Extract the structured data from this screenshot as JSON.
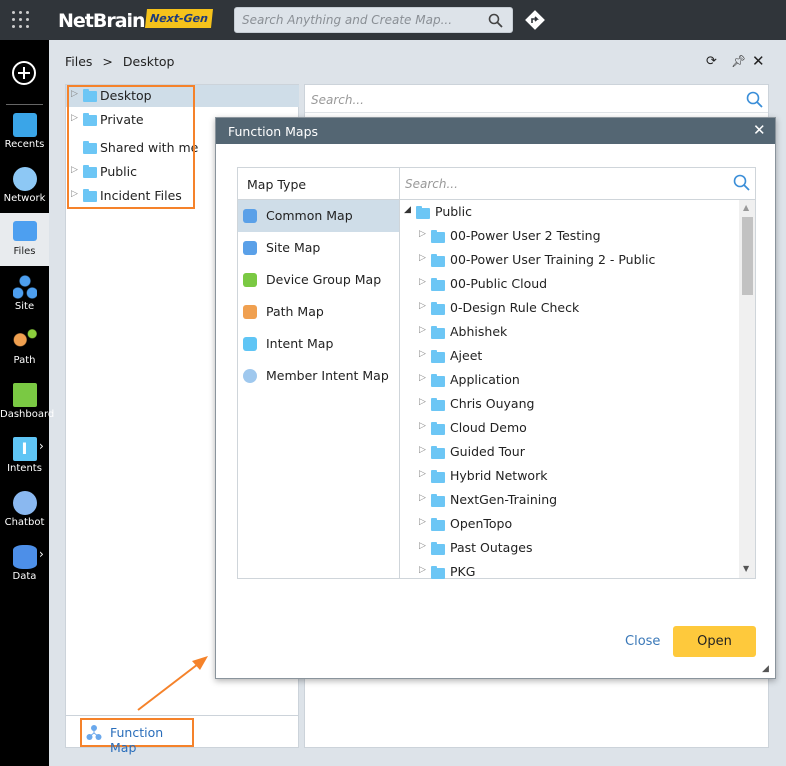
{
  "topbar": {
    "logo": "NetBrain",
    "logo_badge": "Next-Gen",
    "search_placeholder": "Search Anything and Create Map..."
  },
  "sidebar": {
    "items": [
      {
        "label": "Recents",
        "icon": "recents-icon"
      },
      {
        "label": "Network",
        "icon": "network-icon"
      },
      {
        "label": "Files",
        "icon": "files-icon",
        "active": true
      },
      {
        "label": "Site",
        "icon": "site-icon"
      },
      {
        "label": "Path",
        "icon": "path-icon"
      },
      {
        "label": "Dashboard",
        "icon": "dashboard-icon"
      },
      {
        "label": "Intents",
        "icon": "intents-icon"
      },
      {
        "label": "Chatbot",
        "icon": "chatbot-icon"
      },
      {
        "label": "Data",
        "icon": "data-icon"
      }
    ]
  },
  "breadcrumb": {
    "root": "Files",
    "sep": ">",
    "current": "Desktop"
  },
  "file_tree": [
    {
      "label": "Desktop",
      "expandable": true,
      "selected": true
    },
    {
      "label": "Private",
      "expandable": true
    },
    {
      "label": "Shared with me",
      "expandable": false
    },
    {
      "label": "Public",
      "expandable": true
    },
    {
      "label": "Incident Files",
      "expandable": true
    }
  ],
  "right_search_placeholder": "Search...",
  "function_map_label": "Function Map",
  "dialog": {
    "title": "Function Maps",
    "map_type_header": "Map Type",
    "search_placeholder": "Search...",
    "map_types": [
      {
        "label": "Common Map",
        "selected": true
      },
      {
        "label": "Site Map"
      },
      {
        "label": "Device Group Map"
      },
      {
        "label": "Path Map"
      },
      {
        "label": "Intent Map"
      },
      {
        "label": "Member Intent Map"
      }
    ],
    "root_folder": "Public",
    "folders": [
      "00-Power User 2 Testing",
      "00-Power User Training 2 - Public",
      "00-Public Cloud",
      "0-Design Rule Check",
      "Abhishek",
      "Ajeet",
      "Application",
      "Chris Ouyang",
      "Cloud Demo",
      "Guided Tour",
      "Hybrid Network",
      "NextGen-Training",
      "OpenTopo",
      "Past Outages",
      "PKG"
    ],
    "close_label": "Close",
    "open_label": "Open"
  },
  "colors": {
    "accent_orange": "#f5822a",
    "open_button": "#fec93c",
    "dialog_header": "#546673",
    "topbar": "#30353a"
  }
}
